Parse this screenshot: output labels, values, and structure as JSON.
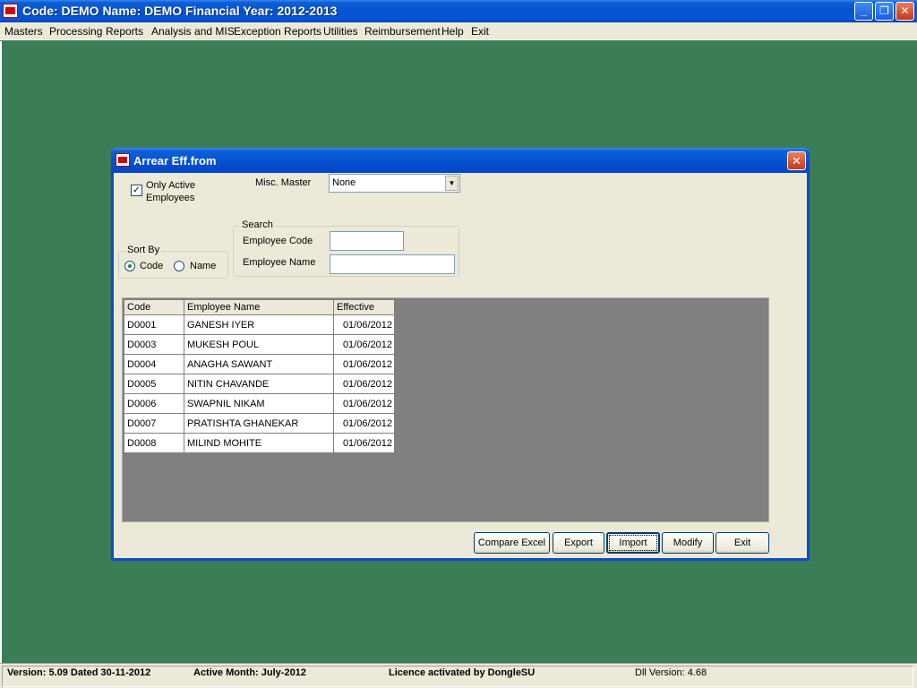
{
  "app": {
    "title": "Code: DEMO Name: DEMO Financial Year: 2012-2013",
    "caption_min": "_",
    "caption_max": "❐",
    "caption_close": "✕"
  },
  "menu": [
    "Masters",
    "Processing",
    "Reports",
    "Analysis and MIS",
    "Exception Reports",
    "Utilities",
    "Reimbursement",
    "Help",
    "Exit"
  ],
  "dialog": {
    "title": "Arrear Eff.from",
    "close": "✕",
    "only_active_label": "Only Active Employees",
    "only_active_checked": true,
    "check_mark": "✓",
    "misc_master_label": "Misc. Master",
    "misc_master_value": "None",
    "combo_arrow": "▼",
    "sort_by": {
      "title": "Sort By",
      "code_label": "Code",
      "name_label": "Name",
      "selected": "Code"
    },
    "search": {
      "title": "Search",
      "emp_code_label": "Employee Code",
      "emp_code_value": "",
      "emp_name_label": "Employee Name",
      "emp_name_value": ""
    },
    "grid": {
      "headers": [
        "Code",
        "Employee Name",
        "Effective"
      ],
      "rows": [
        [
          "D0001",
          "GANESH IYER",
          "01/06/2012"
        ],
        [
          "D0003",
          "MUKESH POUL",
          "01/06/2012"
        ],
        [
          "D0004",
          "ANAGHA SAWANT",
          "01/06/2012"
        ],
        [
          "D0005",
          "NITIN CHAVANDE",
          "01/06/2012"
        ],
        [
          "D0006",
          "SWAPNIL NIKAM",
          "01/06/2012"
        ],
        [
          "D0007",
          "PRATISHTA GHANEKAR",
          "01/06/2012"
        ],
        [
          "D0008",
          "MILIND MOHITE",
          "01/06/2012"
        ]
      ]
    },
    "buttons": {
      "compare_excel": "Compare Excel",
      "export": "Export",
      "import": "Import",
      "modify": "Modify",
      "exit": "Exit"
    }
  },
  "status": {
    "version": "Version: 5.09 Dated 30-11-2012",
    "active_month": "Active Month: July-2012",
    "licence": "Licence activated by DongleSU",
    "dll_version": "Dll Version: 4.68"
  },
  "colors": {
    "desktop": "#3a7d57",
    "titlebar": "#0453d0",
    "face": "#ece9d8",
    "grid_bg": "#808080"
  }
}
